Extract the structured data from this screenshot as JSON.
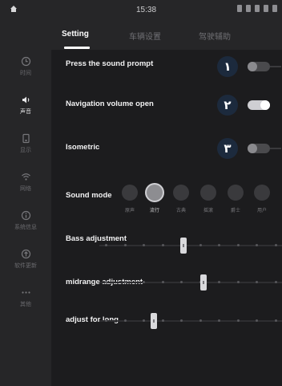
{
  "status_bar": {
    "time": "15:38"
  },
  "tabs": [
    {
      "label": "Setting",
      "active": true
    },
    {
      "label": "车辆设置",
      "active": false
    },
    {
      "label": "驾驶辅助",
      "active": false
    }
  ],
  "sidebar": {
    "items": [
      {
        "icon": "clock-icon",
        "label": "时间",
        "active": false
      },
      {
        "icon": "speaker-icon",
        "label": "声音",
        "active": true
      },
      {
        "icon": "display-icon",
        "label": "显示",
        "active": false
      },
      {
        "icon": "wifi-icon",
        "label": "网络",
        "active": false
      },
      {
        "icon": "info-icon",
        "label": "系统信息",
        "active": false
      },
      {
        "icon": "update-icon",
        "label": "软件更新",
        "active": false
      },
      {
        "icon": "more-icon",
        "label": "其他",
        "active": false
      }
    ]
  },
  "settings": {
    "press_sound_prompt": {
      "label": "Press the sound prompt",
      "on": false,
      "badge": "١"
    },
    "navigation_volume": {
      "label": "Navigation volume open",
      "on": true,
      "badge": "٢"
    },
    "isometric": {
      "label": "Isometric",
      "on": false,
      "badge": "٣"
    }
  },
  "sound_mode": {
    "label": "Sound mode",
    "options": [
      {
        "label": "原声",
        "icon": "original-sound-icon",
        "active": false
      },
      {
        "label": "流行",
        "icon": "pop-icon",
        "active": true
      },
      {
        "label": "古典",
        "icon": "classical-icon",
        "active": false
      },
      {
        "label": "摇滚",
        "icon": "rock-icon",
        "active": false
      },
      {
        "label": "爵士",
        "icon": "jazz-icon",
        "active": false
      },
      {
        "label": "用户",
        "icon": "user-icon",
        "active": false
      }
    ]
  },
  "sliders": {
    "bass": {
      "label": "Bass adjustment",
      "level": 0.46
    },
    "midrange": {
      "label": "midrange adjustment",
      "level": 0.57
    },
    "long": {
      "label": "adjust for long",
      "level": 0.3
    }
  }
}
